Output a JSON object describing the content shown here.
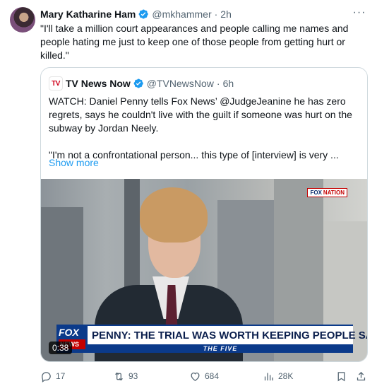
{
  "tweet": {
    "author_name": "Mary Katharine Ham",
    "author_handle": "@mkhammer",
    "separator": "·",
    "time": "2h",
    "text": "\"I'll take a million court appearances and people calling me names and people hating me just to keep one of those people from getting hurt or killed.\"",
    "avatar_icon": "avatar-photo",
    "verified_icon": "verified-badge-icon",
    "more_label": "···"
  },
  "quote": {
    "logo_text": "TV",
    "author_name": "TV News Now",
    "author_handle": "@TVNewsNow",
    "separator": "·",
    "time": "6h",
    "paragraph1": "WATCH:  Daniel Penny tells Fox News’ @JudgeJeanine he has zero regrets, says he couldn't live with the guilt if someone was hurt on the subway by Jordan Neely.",
    "paragraph2": "\"I'm not a confrontational person... this type of [interview] is very ...",
    "show_more": "Show more"
  },
  "video": {
    "network_bug": "FOX",
    "network_bug_red": "NATION",
    "chyron_logo": "FOX",
    "chyron_logo_small": "NEWS",
    "chyron_text": "PENNY: THE TRIAL WAS WORTH KEEPING PEOPLE SAFE",
    "show_name": "THE FIVE",
    "duration": "0:38"
  },
  "actions": {
    "replies": "17",
    "reposts": "93",
    "likes": "684",
    "views": "28K"
  },
  "colors": {
    "accent": "#1d9bf0",
    "text": "#0f1419",
    "muted": "#536471",
    "border": "#cfd9de"
  }
}
